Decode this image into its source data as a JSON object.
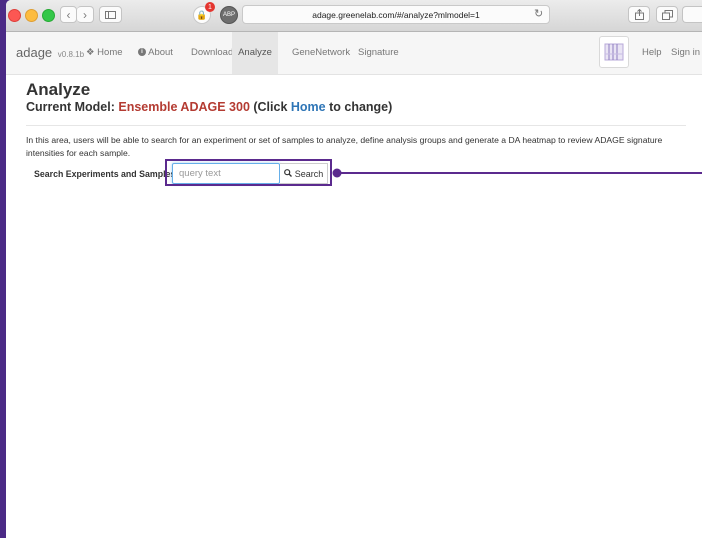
{
  "browser": {
    "url": "adage.greenelab.com/#/analyze?mlmodel=1",
    "badge_count": "1",
    "ext_label": "ABP"
  },
  "nav": {
    "brand": "adage",
    "version": "v0.8.1b",
    "items": [
      {
        "label": "Home",
        "icon": "home-icon"
      },
      {
        "label": "About",
        "icon": "info-icon"
      },
      {
        "label": "Download"
      },
      {
        "label": "Analyze",
        "active": true
      },
      {
        "label": "GeneNetwork"
      },
      {
        "label": "Signature"
      }
    ],
    "help": "Help",
    "signin": "Sign in"
  },
  "page": {
    "title": "Analyze",
    "subtitle_prefix": "Current Model: ",
    "model_name": "Ensemble ADAGE 300",
    "subtitle_mid": " (Click ",
    "home_link": "Home",
    "subtitle_suffix": " to change)",
    "description": "In this area, users will be able to search for an experiment or set of samples to analyze, define analysis groups and generate a DA heatmap to review ADAGE signature intensities for each sample.",
    "search_label": "Search Experiments and Samples",
    "search_placeholder": "query text",
    "search_button": "Search"
  },
  "colors": {
    "accent": "#5b2a8e",
    "model_red": "#b43b32",
    "link_blue": "#2e75b6"
  }
}
